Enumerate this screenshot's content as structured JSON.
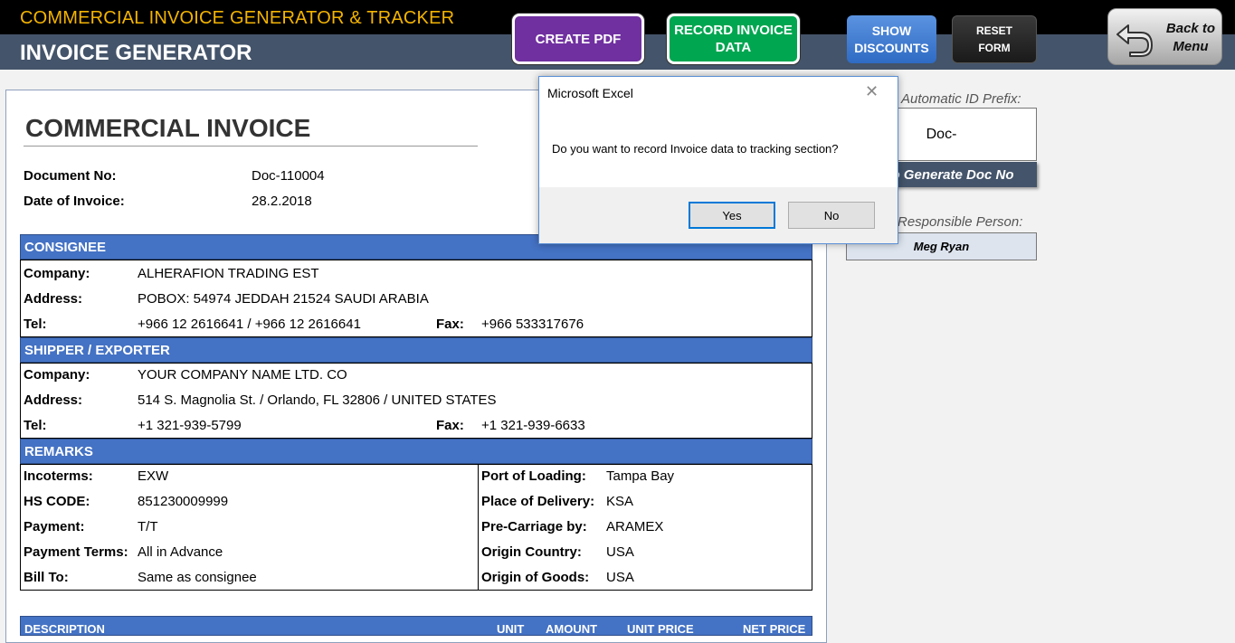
{
  "header": {
    "app_title": "COMMERCIAL INVOICE GENERATOR & TRACKER",
    "page_subtitle": "INVOICE GENERATOR",
    "buttons": {
      "create_pdf": "CREATE PDF",
      "record_line1": "RECORD INVOICE",
      "record_line2": "DATA",
      "discounts_line1": "SHOW",
      "discounts_line2": "DISCOUNTS",
      "reset_line1": "RESET",
      "reset_line2": "FORM",
      "back_line1": "Back to",
      "back_line2": "Menu"
    },
    "colors": {
      "title": "#f4b400",
      "pdf": "#7030a0",
      "record": "#00a650",
      "discounts": "#2f6bc4",
      "section": "#4472c4"
    }
  },
  "invoice": {
    "title": "COMMERCIAL INVOICE",
    "doc_no_label": "Document No:",
    "doc_no": "Doc-110004",
    "date_label": "Date of Invoice:",
    "date": "28.2.2018",
    "consignee": {
      "heading": "CONSIGNEE",
      "company_label": "Company:",
      "company": "ALHERAFION TRADING EST",
      "address_label": "Address:",
      "address": "POBOX: 54974 JEDDAH 21524 SAUDI ARABIA",
      "tel_label": "Tel:",
      "tel": "+966 12 2616641 / +966 12 2616641",
      "fax_label": "Fax:",
      "fax": "+966 533317676"
    },
    "shipper": {
      "heading": "SHIPPER / EXPORTER",
      "company_label": "Company:",
      "company": "YOUR COMPANY NAME LTD. CO",
      "address_label": "Address:",
      "address": "514 S. Magnolia St. / Orlando, FL 32806 / UNITED STATES",
      "tel_label": "Tel:",
      "tel": "+1 321-939-5799",
      "fax_label": "Fax:",
      "fax": "+1 321-939-6633"
    },
    "remarks": {
      "heading": "REMARKS",
      "left": [
        {
          "label": "Incoterms:",
          "value": "EXW"
        },
        {
          "label": "HS CODE:",
          "value": "851230009999"
        },
        {
          "label": "Payment:",
          "value": "T/T"
        },
        {
          "label": "Payment Terms:",
          "value": "All in Advance"
        },
        {
          "label": "Bill To:",
          "value": "Same as consignee"
        }
      ],
      "right": [
        {
          "label": "Port of Loading:",
          "value": "Tampa Bay"
        },
        {
          "label": "Place of Delivery:",
          "value": "KSA"
        },
        {
          "label": "Pre-Carriage by:",
          "value": "ARAMEX"
        },
        {
          "label": "Origin Country:",
          "value": "USA"
        },
        {
          "label": "Origin of Goods:",
          "value": "USA"
        }
      ]
    },
    "items_header": {
      "description": "DESCRIPTION",
      "unit": "UNIT",
      "amount": "AMOUNT",
      "unit_price": "UNIT PRICE",
      "net_price": "NET PRICE"
    }
  },
  "side_panel": {
    "prefix_label": "Automatic ID Prefix:",
    "prefix_value": "Doc-",
    "autogen_button": "Auto Generate Doc No",
    "responsible_label": "Responsible Person:",
    "responsible_value": "Meg Ryan"
  },
  "dialog": {
    "title": "Microsoft Excel",
    "message": "Do you want to record Invoice data to tracking section?",
    "yes": "Yes",
    "no": "No"
  }
}
